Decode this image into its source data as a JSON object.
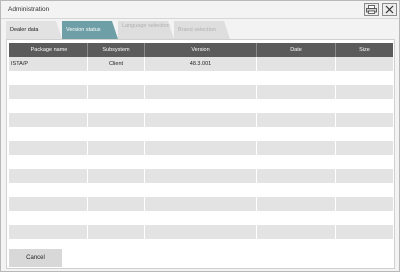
{
  "window": {
    "title": "Administration",
    "print_icon": "print-icon",
    "close_icon": "close-icon"
  },
  "tabs": [
    {
      "label": "Dealer data",
      "state": "normal"
    },
    {
      "label": "Version status",
      "state": "active"
    },
    {
      "label": "Language selection",
      "state": "disabled"
    },
    {
      "label": "Brand selection",
      "state": "disabled"
    }
  ],
  "table": {
    "headers": [
      "Package name",
      "Subsystem",
      "Version",
      "Date",
      "Size"
    ],
    "rows": [
      [
        "ISTA/P",
        "Client",
        "48.3.001",
        "",
        ""
      ],
      [
        "",
        "",
        "",
        "",
        ""
      ],
      [
        "",
        "",
        "",
        "",
        ""
      ],
      [
        "",
        "",
        "",
        "",
        ""
      ],
      [
        "",
        "",
        "",
        "",
        ""
      ],
      [
        "",
        "",
        "",
        "",
        ""
      ],
      [
        "",
        "",
        "",
        "",
        ""
      ],
      [
        "",
        "",
        "",
        "",
        ""
      ],
      [
        "",
        "",
        "",
        "",
        ""
      ],
      [
        "",
        "",
        "",
        "",
        ""
      ],
      [
        "",
        "",
        "",
        "",
        ""
      ],
      [
        "",
        "",
        "",
        "",
        ""
      ],
      [
        "",
        "",
        "",
        "",
        ""
      ]
    ]
  },
  "footer": {
    "cancel_label": "Cancel"
  },
  "colors": {
    "active_tab": "#6f9fa6",
    "header_bg": "#5b5b5b",
    "row_gray": "#e3e3e3"
  }
}
